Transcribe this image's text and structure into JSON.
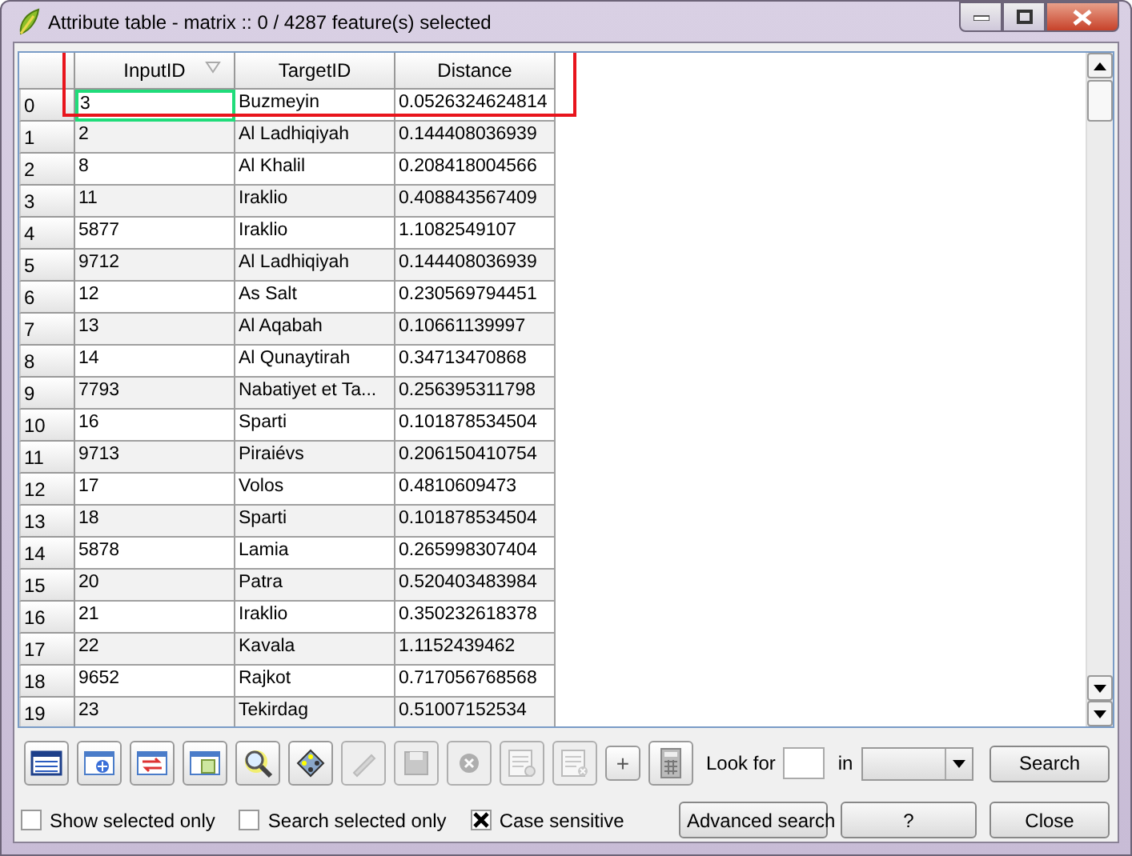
{
  "window": {
    "title": "Attribute table - matrix :: 0 / 4287 feature(s) selected"
  },
  "table": {
    "columns": [
      {
        "label": "InputID",
        "sorted": true
      },
      {
        "label": "TargetID",
        "sorted": false
      },
      {
        "label": "Distance",
        "sorted": false
      }
    ],
    "rows": [
      {
        "header": "0",
        "cells": [
          "3",
          "Buzmeyin",
          "0.0526324624814"
        ],
        "focused": true
      },
      {
        "header": "1",
        "cells": [
          "2",
          "Al Ladhiqiyah",
          "0.144408036939"
        ],
        "focused": false
      },
      {
        "header": "2",
        "cells": [
          "8",
          "Al Khalil",
          "0.208418004566"
        ],
        "focused": false
      },
      {
        "header": "3",
        "cells": [
          "11",
          "Iraklio",
          "0.408843567409"
        ],
        "focused": false
      },
      {
        "header": "4",
        "cells": [
          "5877",
          "Iraklio",
          "1.1082549107"
        ],
        "focused": false
      },
      {
        "header": "5",
        "cells": [
          "9712",
          "Al Ladhiqiyah",
          "0.144408036939"
        ],
        "focused": false
      },
      {
        "header": "6",
        "cells": [
          "12",
          "As Salt",
          "0.230569794451"
        ],
        "focused": false
      },
      {
        "header": "7",
        "cells": [
          "13",
          "Al Aqabah",
          "0.10661139997"
        ],
        "focused": false
      },
      {
        "header": "8",
        "cells": [
          "14",
          "Al Qunaytirah",
          "0.34713470868"
        ],
        "focused": false
      },
      {
        "header": "9",
        "cells": [
          "7793",
          "Nabatiyet et Ta...",
          "0.256395311798"
        ],
        "focused": false
      },
      {
        "header": "10",
        "cells": [
          "16",
          "Sparti",
          "0.101878534504"
        ],
        "focused": false
      },
      {
        "header": "11",
        "cells": [
          "9713",
          "Piraiévs",
          "0.206150410754"
        ],
        "focused": false
      },
      {
        "header": "12",
        "cells": [
          "17",
          "Volos",
          "0.4810609473"
        ],
        "focused": false
      },
      {
        "header": "13",
        "cells": [
          "18",
          "Sparti",
          "0.101878534504"
        ],
        "focused": false
      },
      {
        "header": "14",
        "cells": [
          "5878",
          "Lamia",
          "0.265998307404"
        ],
        "focused": false
      },
      {
        "header": "15",
        "cells": [
          "20",
          "Patra",
          "0.520403483984"
        ],
        "focused": false
      },
      {
        "header": "16",
        "cells": [
          "21",
          "Iraklio",
          "0.350232618378"
        ],
        "focused": false
      },
      {
        "header": "17",
        "cells": [
          "22",
          "Kavala",
          "1.1152439462"
        ],
        "focused": false
      },
      {
        "header": "18",
        "cells": [
          "9652",
          "Rajkot",
          "0.717056768568"
        ],
        "focused": false
      },
      {
        "header": "19",
        "cells": [
          "23",
          "Tekirdag",
          "0.51007152534"
        ],
        "focused": false
      }
    ]
  },
  "toolbar": [
    {
      "kind": "table",
      "disabled": false
    },
    {
      "kind": "table-select",
      "disabled": false
    },
    {
      "kind": "table-swap",
      "disabled": false
    },
    {
      "kind": "table-pan",
      "disabled": false
    },
    {
      "kind": "zoom",
      "disabled": false
    },
    {
      "kind": "move",
      "disabled": false
    },
    {
      "kind": "pencil",
      "disabled": true
    },
    {
      "kind": "save",
      "disabled": true
    },
    {
      "kind": "delete",
      "disabled": true
    },
    {
      "kind": "form",
      "disabled": true
    },
    {
      "kind": "form-remove",
      "disabled": true
    },
    {
      "kind": "text",
      "label": "+",
      "disabled": false
    },
    {
      "kind": "calculator",
      "disabled": false
    }
  ],
  "search": {
    "look_for_label": "Look for",
    "in_label": "in",
    "button": "Search"
  },
  "options": [
    {
      "label": "Show selected only",
      "checked": false
    },
    {
      "label": "Search selected only",
      "checked": false
    },
    {
      "label": "Case sensitive",
      "checked": true
    }
  ],
  "buttons": [
    "Advanced search",
    "?",
    "Close"
  ]
}
